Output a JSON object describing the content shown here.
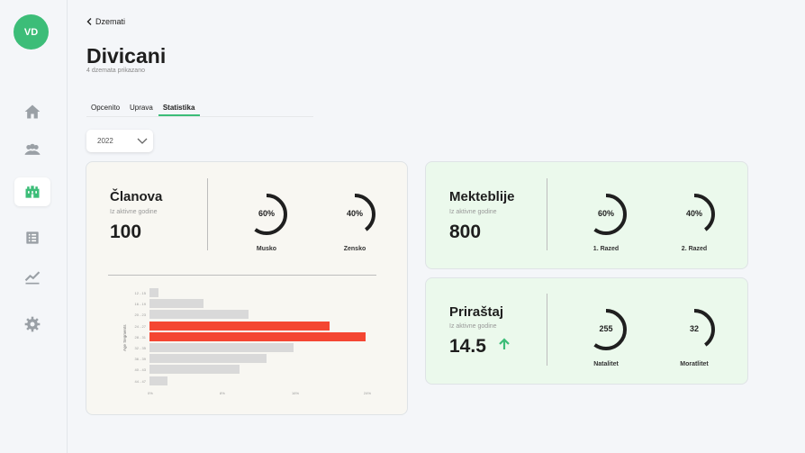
{
  "user": {
    "initials": "VD",
    "avatar_color": "#3cbd78"
  },
  "nav": [
    {
      "name": "home",
      "icon": "home-icon",
      "active": false
    },
    {
      "name": "members",
      "icon": "users-icon",
      "active": false
    },
    {
      "name": "buildings",
      "icon": "building-icon",
      "active": true
    },
    {
      "name": "list",
      "icon": "list-icon",
      "active": false
    },
    {
      "name": "stats",
      "icon": "trend-icon",
      "active": false
    },
    {
      "name": "settings",
      "icon": "gear-icon",
      "active": false
    }
  ],
  "back": {
    "label": "Dzemati"
  },
  "header": {
    "title": "Divicani",
    "subtitle": "4 dzemata prikazano"
  },
  "tabs": [
    {
      "label": "Opcenito",
      "active": false
    },
    {
      "label": "Uprava",
      "active": false
    },
    {
      "label": "Statistika",
      "active": true
    }
  ],
  "year_select": {
    "value": "2022"
  },
  "colors": {
    "accent": "#3cbd78",
    "highlight_bar": "#f44632",
    "bar": "#d9d9d9",
    "ring": "#1f1f1f"
  },
  "cards": {
    "clanova": {
      "title": "Članova",
      "subtitle": "Iz aktivne godine",
      "value": "100",
      "rings": [
        {
          "label": "60%",
          "caption": "Musko",
          "fraction": 0.6
        },
        {
          "label": "40%",
          "caption": "Zensko",
          "fraction": 0.4
        }
      ]
    },
    "mekteblije": {
      "title": "Mekteblije",
      "subtitle": "Iz aktivne godine",
      "value": "800",
      "rings": [
        {
          "label": "60%",
          "caption": "1. Razed",
          "fraction": 0.6
        },
        {
          "label": "40%",
          "caption": "2. Razed",
          "fraction": 0.4
        }
      ]
    },
    "prirastaj": {
      "title": "Priraštaj",
      "subtitle": "Iz aktivne godine",
      "value": "14.5",
      "trend_icon": "arrow-up-icon",
      "rings": [
        {
          "label": "255",
          "caption": "Natalitet",
          "fraction": 0.6
        },
        {
          "label": "32",
          "caption": "Moratlitet",
          "fraction": 0.4
        }
      ]
    }
  },
  "chart_data": {
    "type": "bar",
    "orientation": "horizontal",
    "ylabel": "Age Segments",
    "categories": [
      "12 - 15",
      "16 - 19",
      "20 - 23",
      "24 - 27",
      "28 - 31",
      "32 - 35",
      "36 - 39",
      "40 - 43",
      "44 - 47"
    ],
    "values": [
      1,
      6,
      11,
      20,
      24,
      16,
      13,
      10,
      2
    ],
    "highlighted": [
      3,
      4
    ],
    "x_ticks": [
      "0%",
      "8%",
      "16%",
      "24%"
    ],
    "xlim": [
      0,
      24
    ]
  }
}
